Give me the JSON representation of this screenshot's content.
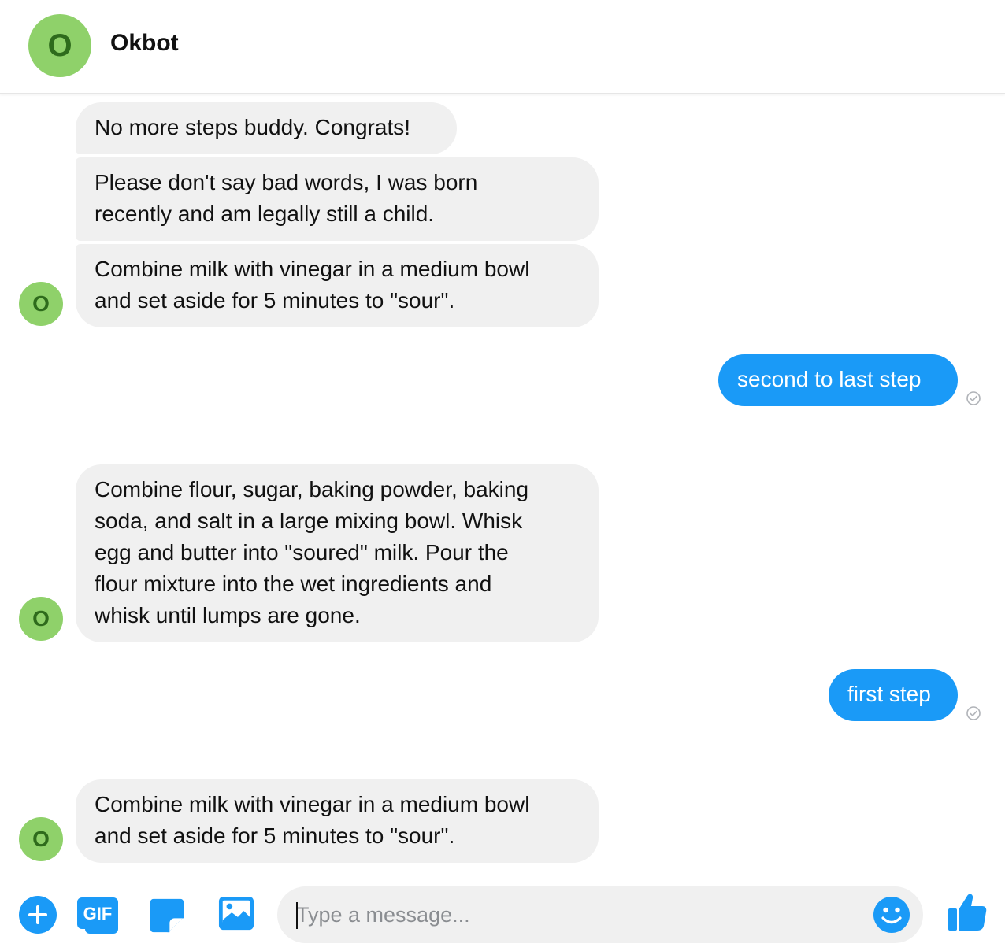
{
  "header": {
    "avatar_letter": "O",
    "title": "Okbot"
  },
  "colors": {
    "bot_bubble": "#f0f0f0",
    "user_bubble": "#1a9af7",
    "avatar_bg": "#8fd16a",
    "avatar_fg": "#2e6b1c",
    "accent": "#1a9af7"
  },
  "messages": [
    {
      "sender": "bot",
      "text": "No more steps buddy. Congrats!"
    },
    {
      "sender": "bot",
      "text": "Please don't say bad words, I was born\nrecently and am legally still a child."
    },
    {
      "sender": "bot",
      "text": "Combine milk with vinegar in a medium bowl\nand set aside for 5 minutes to \"sour\"."
    },
    {
      "sender": "user",
      "text": "second to last step"
    },
    {
      "sender": "bot",
      "text": "Combine flour, sugar, baking powder, baking\nsoda, and salt in a large mixing bowl. Whisk\negg and butter into \"soured\" milk. Pour the\nflour mixture into the wet ingredients and\nwhisk until lumps are gone."
    },
    {
      "sender": "user",
      "text": "first step"
    },
    {
      "sender": "bot",
      "text": "Combine milk with vinegar in a medium bowl\nand set aside for 5 minutes to \"sour\"."
    }
  ],
  "bot_avatar_letter": "O",
  "composer": {
    "placeholder": "Type a message...",
    "value": "",
    "gif_label": "GIF",
    "icons": [
      "plus-icon",
      "gif-icon",
      "sticker-icon",
      "image-icon",
      "emoji-icon",
      "thumbs-up-icon"
    ]
  }
}
